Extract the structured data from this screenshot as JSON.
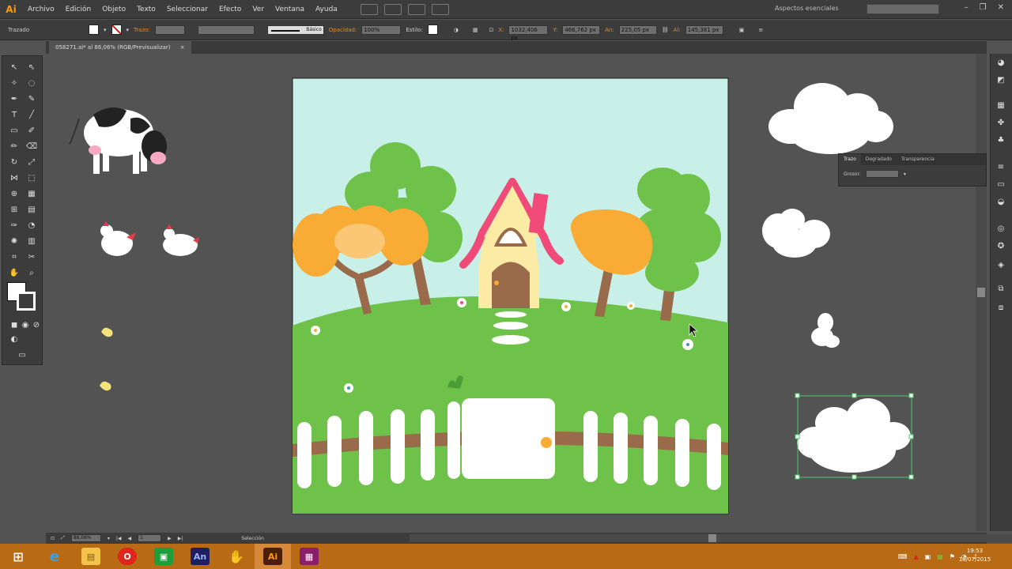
{
  "menubar": {
    "logo": "Ai",
    "items": [
      "Archivo",
      "Edición",
      "Objeto",
      "Texto",
      "Seleccionar",
      "Efecto",
      "Ver",
      "Ventana",
      "Ayuda"
    ],
    "workspace": "Aspectos esenciales",
    "window_buttons": [
      "–",
      "❐",
      "✕"
    ]
  },
  "controlbar": {
    "selection_label": "Trazado",
    "stroke_label": "Trazo:",
    "brush_label": "Básico",
    "opacity_label": "Opacidad:",
    "opacity_value": "100%",
    "style_label": "Estilo:",
    "x_label": "X:",
    "x_value": "1032,406 px",
    "y_label": "Y:",
    "y_value": "466,762 px",
    "w_label": "An:",
    "w_value": "225,05 px",
    "h_label": "Al:",
    "h_value": "145,381 px"
  },
  "document_tab": {
    "title": "058271.ai* al 86,06% (RGB/Previsualizar)",
    "close": "×"
  },
  "stroke_panel": {
    "tabs": [
      "Trazo",
      "Degradado",
      "Transparencia"
    ],
    "weight_label": "Grosor:"
  },
  "statusbar": {
    "zoom": "86,06%",
    "page": "1",
    "tool": "Selección"
  },
  "taskbar": {
    "clock_time": "19:53",
    "clock_date": "18/07/2015",
    "apps": [
      {
        "name": "windows-start",
        "glyph": "⊞",
        "color": "#ffffff"
      },
      {
        "name": "internet-explorer",
        "glyph": "e",
        "color": "#3aa0e8"
      },
      {
        "name": "file-explorer",
        "glyph": "▤",
        "color": "#f4c44a"
      },
      {
        "name": "opera",
        "glyph": "O",
        "color": "#e0241e"
      },
      {
        "name": "store",
        "glyph": "▣",
        "color": "#1e9e3a"
      },
      {
        "name": "animate",
        "glyph": "An",
        "color": "#1f1f5e"
      },
      {
        "name": "app-glove",
        "glyph": "✋",
        "color": "#c86a1a"
      },
      {
        "name": "illustrator",
        "glyph": "Ai",
        "color": "#4a1e0a"
      },
      {
        "name": "winrar",
        "glyph": "▦",
        "color": "#8a1e6a"
      }
    ]
  }
}
